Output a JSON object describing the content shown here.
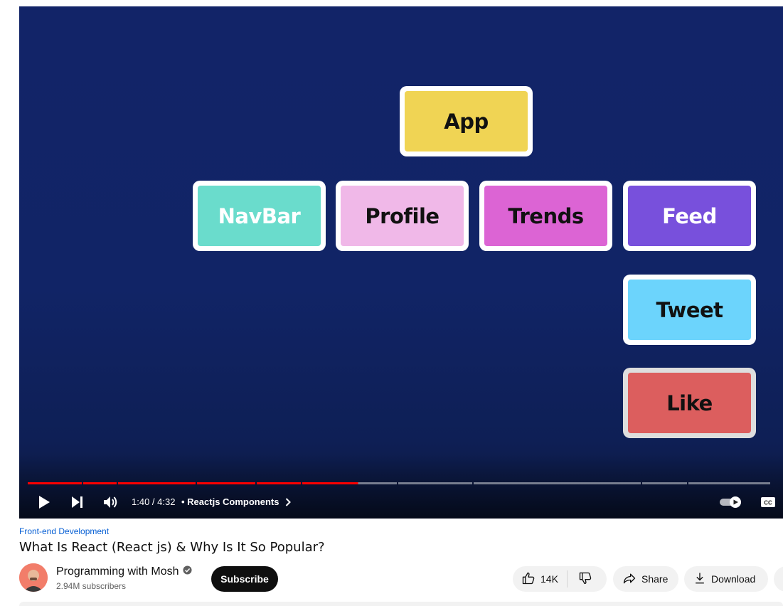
{
  "video": {
    "tiles": [
      {
        "id": "app",
        "label": "App",
        "color": "#f0d454"
      },
      {
        "id": "navbar",
        "label": "NavBar",
        "color": "#6adccc"
      },
      {
        "id": "profile",
        "label": "Profile",
        "color": "#f0b8e8"
      },
      {
        "id": "trends",
        "label": "Trends",
        "color": "#dc64d4"
      },
      {
        "id": "feed",
        "label": "Feed",
        "color": "#7850dc"
      },
      {
        "id": "tweet",
        "label": "Tweet",
        "color": "#6cd4fc"
      },
      {
        "id": "like",
        "label": "Like",
        "color": "#dc5e5e"
      }
    ],
    "controls": {
      "current_time": "1:40",
      "duration": "4:32",
      "time_display": "1:40 / 4:32",
      "chapter": "Reactjs Components",
      "progress_fraction": 0.43,
      "autoplay_on": true,
      "play_icon": "play-icon",
      "next_icon": "next-icon",
      "volume_icon": "volume-icon",
      "cc_label": "CC"
    }
  },
  "meta": {
    "category": "Front-end Development",
    "title": "What Is React (React js) & Why Is It So Popular?",
    "channel": {
      "name": "Programming with Mosh",
      "verified": true,
      "subscribers": "2.94M subscribers"
    },
    "subscribe_label": "Subscribe",
    "actions": {
      "likes": "14K",
      "share_label": "Share",
      "download_label": "Download"
    }
  },
  "colors": {
    "accent_red": "#ff0000",
    "video_bg": "#122468",
    "link_blue": "#065fd4"
  }
}
